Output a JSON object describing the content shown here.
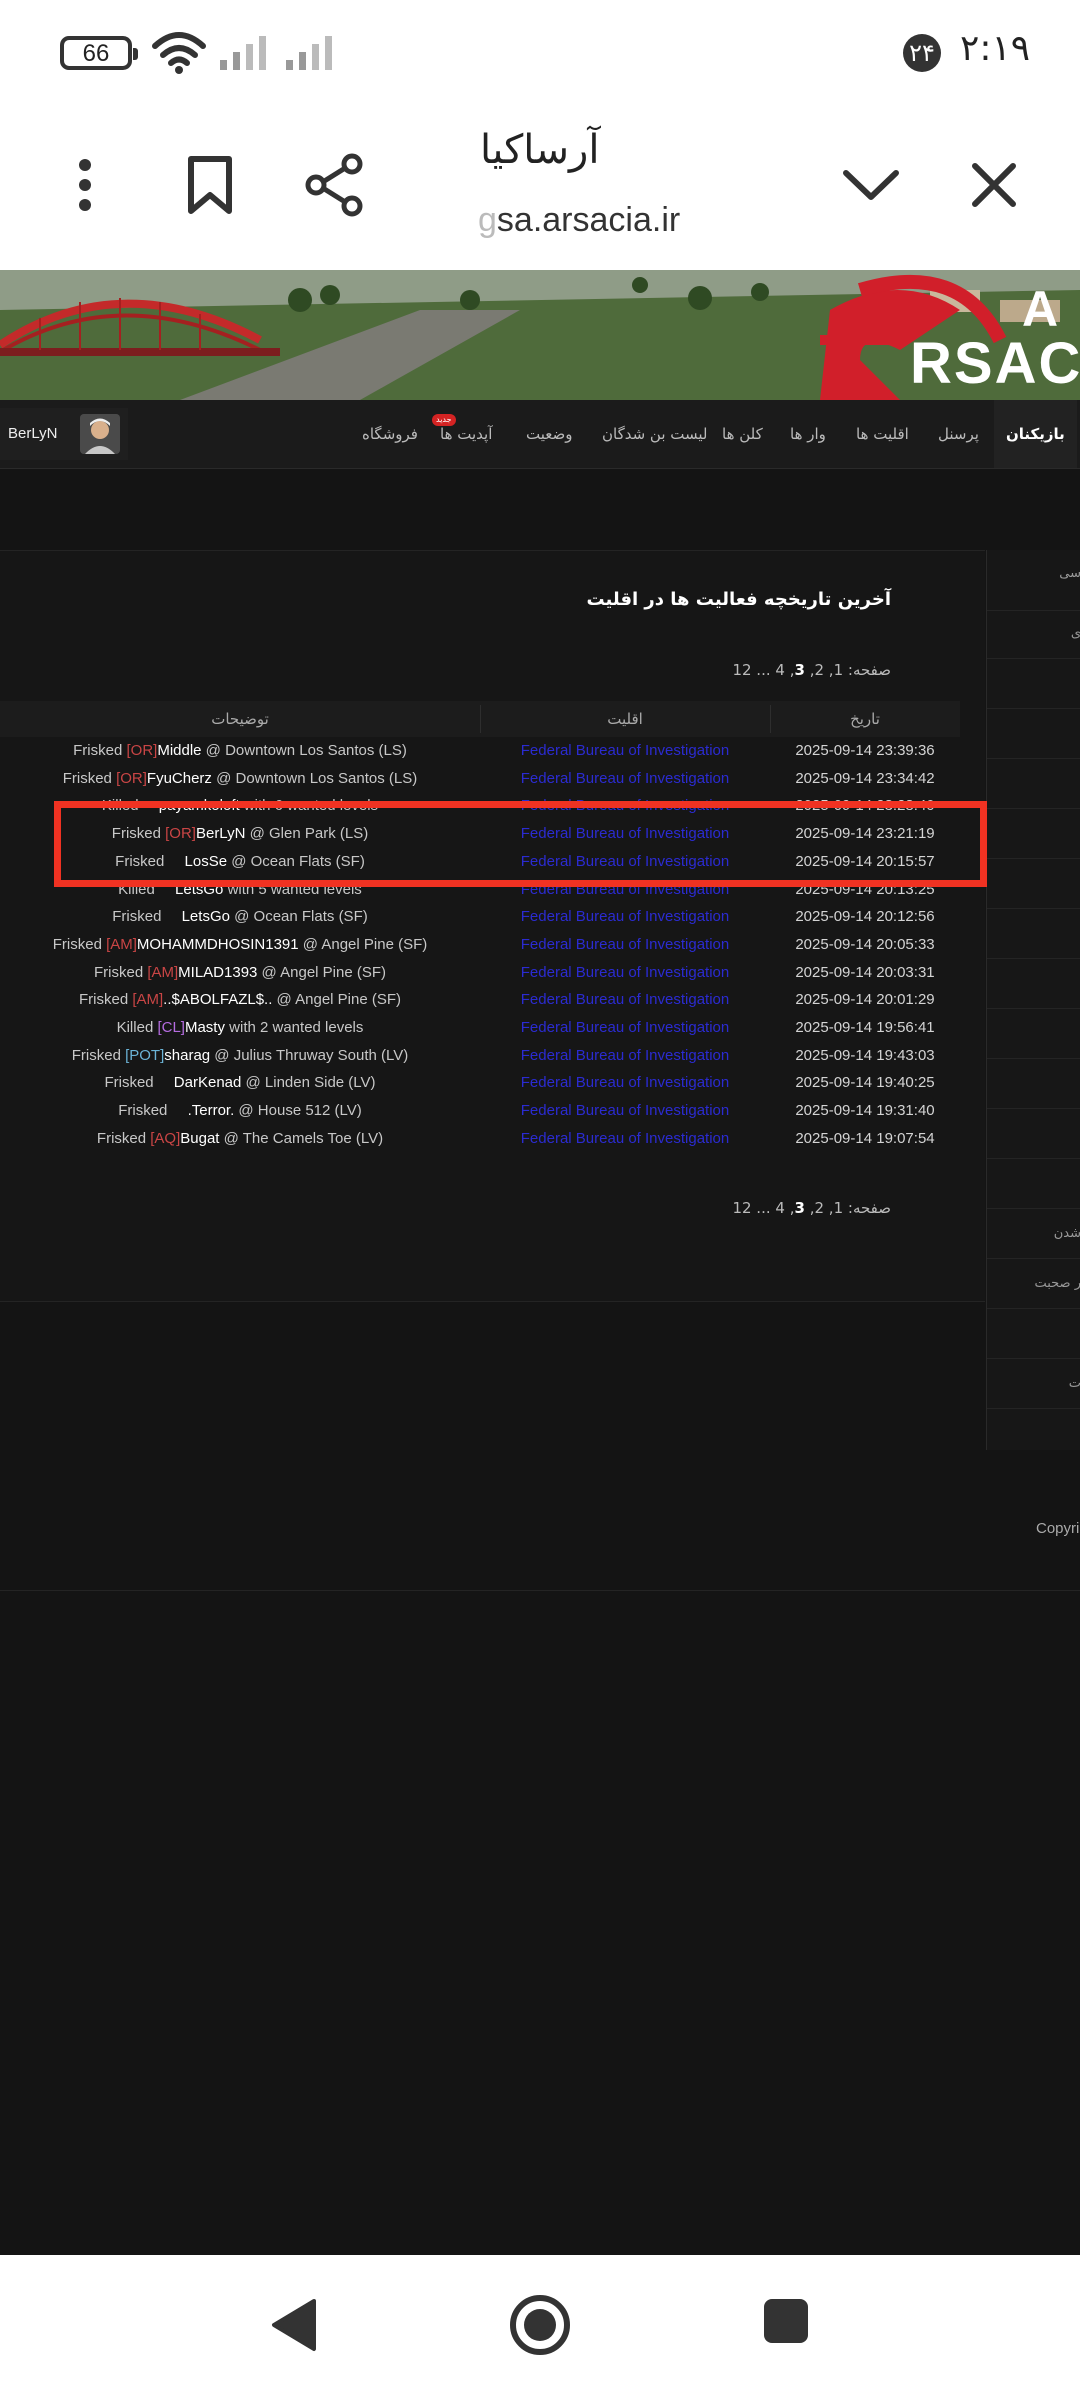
{
  "status_bar": {
    "battery": "66",
    "notification_badge": "۲۴",
    "time": "۲:۱۹",
    "icons": [
      "battery-icon",
      "wifi-icon",
      "signal-icon",
      "signal-icon"
    ]
  },
  "browser": {
    "title": "آرساکیا",
    "url_faded": "g",
    "url": "sa.arsacia.ir",
    "icons": [
      "more-icon",
      "bookmark-icon",
      "share-icon",
      "chevron-down-icon",
      "close-icon"
    ]
  },
  "header": {
    "logo_text": "RSAC",
    "logo_letter": "A"
  },
  "nav": {
    "items": [
      {
        "label": "بازیکنان",
        "active": true
      },
      {
        "label": "پرسنل"
      },
      {
        "label": "اقلیت ها"
      },
      {
        "label": "وار ها"
      },
      {
        "label": "کلن ها"
      },
      {
        "label": "لیست بن شدگان"
      },
      {
        "label": "وضعیت"
      },
      {
        "label": "آپدیت ها"
      },
      {
        "label": "فروشگاه"
      }
    ],
    "new_badge": "جدید",
    "user": "BerLyN"
  },
  "content": {
    "title": "آخرین تاریخچه فعالیت ها در اقلیت",
    "pager": {
      "prefix": "صفحه:",
      "pages": "1, 2,",
      "current": "3",
      "rest": ", 4 ... 12"
    },
    "columns": {
      "date": "تاریخ",
      "faction": "اقلیت",
      "desc": "توضیحات"
    },
    "rows": [
      {
        "pre": "Frisked ",
        "tag": "[OR]",
        "tag_type": "red",
        "name": "Middle",
        "post": " @ Downtown Los Santos (LS)",
        "faction": "Federal Bureau of Investigation",
        "date": "2025-09-14 23:39:36"
      },
      {
        "pre": "Frisked ",
        "tag": "[OR]",
        "tag_type": "red",
        "name": "FyuCherz",
        "post": " @ Downtown Los Santos (LS)",
        "faction": "Federal Bureau of Investigation",
        "date": "2025-09-14 23:34:42"
      },
      {
        "pre": "Killed ",
        "tag": "",
        "tag_type": "",
        "name": "payamkoloft",
        "post": " with 6 wanted levels",
        "faction": "Federal Bureau of Investigation",
        "date": "2025-09-14 23:28:40"
      },
      {
        "pre": "Frisked ",
        "tag": "[OR]",
        "tag_type": "red",
        "name": "BerLyN",
        "post": " @ Glen Park (LS)",
        "faction": "Federal Bureau of Investigation",
        "date": "2025-09-14 23:21:19"
      },
      {
        "pre": "Frisked ",
        "tag": "",
        "tag_type": "",
        "name": "LosSe",
        "post": " @ Ocean Flats (SF)",
        "faction": "Federal Bureau of Investigation",
        "date": "2025-09-14 20:15:57"
      },
      {
        "pre": "Killed ",
        "tag": "",
        "tag_type": "",
        "name": "LetsGo",
        "post": " with 5 wanted levels",
        "faction": "Federal Bureau of Investigation",
        "date": "2025-09-14 20:13:25"
      },
      {
        "pre": "Frisked ",
        "tag": "",
        "tag_type": "",
        "name": "LetsGo",
        "post": " @ Ocean Flats (SF)",
        "faction": "Federal Bureau of Investigation",
        "date": "2025-09-14 20:12:56"
      },
      {
        "pre": "Frisked ",
        "tag": "[AM]",
        "tag_type": "red",
        "name": "MOHAMMDHOSIN1391",
        "post": " @ Angel Pine (SF)",
        "faction": "Federal Bureau of Investigation",
        "date": "2025-09-14 20:05:33"
      },
      {
        "pre": "Frisked ",
        "tag": "[AM]",
        "tag_type": "red",
        "name": "MILAD1393",
        "post": " @ Angel Pine (SF)",
        "faction": "Federal Bureau of Investigation",
        "date": "2025-09-14 20:03:31"
      },
      {
        "pre": "Frisked ",
        "tag": "[AM]",
        "tag_type": "red",
        "name": "..$ABOLFAZL$..",
        "post": " @ Angel Pine (SF)",
        "faction": "Federal Bureau of Investigation",
        "date": "2025-09-14 20:01:29"
      },
      {
        "pre": "Killed ",
        "tag": "[CL]",
        "tag_type": "purple",
        "name": "Masty",
        "post": " with 2 wanted levels",
        "faction": "Federal Bureau of Investigation",
        "date": "2025-09-14 19:56:41"
      },
      {
        "pre": "Frisked ",
        "tag": "[POT]",
        "tag_type": "blue",
        "name": "sharag",
        "post": " @ Julius Thruway South (LV)",
        "faction": "Federal Bureau of Investigation",
        "date": "2025-09-14 19:43:03"
      },
      {
        "pre": "Frisked ",
        "tag": "",
        "tag_type": "",
        "name": "DarKenad",
        "post": " @ Linden Side (LV)",
        "faction": "Federal Bureau of Investigation",
        "date": "2025-09-14 19:40:25"
      },
      {
        "pre": "Frisked ",
        "tag": "",
        "tag_type": "",
        "name": ".Terror.",
        "post": " @ House 512 (LV)",
        "faction": "Federal Bureau of Investigation",
        "date": "2025-09-14 19:31:40"
      },
      {
        "pre": "Frisked ",
        "tag": "[AQ]",
        "tag_type": "red",
        "name": "Bugat",
        "post": " @ The Camels Toe (LV)",
        "faction": "Federal Bureau of Investigation",
        "date": "2025-09-14 19:07:54"
      }
    ]
  },
  "sidebar": {
    "items": [
      "سی",
      "ی",
      "",
      "",
      "",
      "",
      "",
      "",
      "",
      "",
      "",
      "",
      "",
      "شدن",
      "ر صحبت",
      "",
      "ت"
    ]
  },
  "footer": {
    "copyright": "Copyri"
  },
  "colors": {
    "highlight": "#f03222",
    "faction_link": "#2b2bd1",
    "tag_red": "#c94545"
  }
}
